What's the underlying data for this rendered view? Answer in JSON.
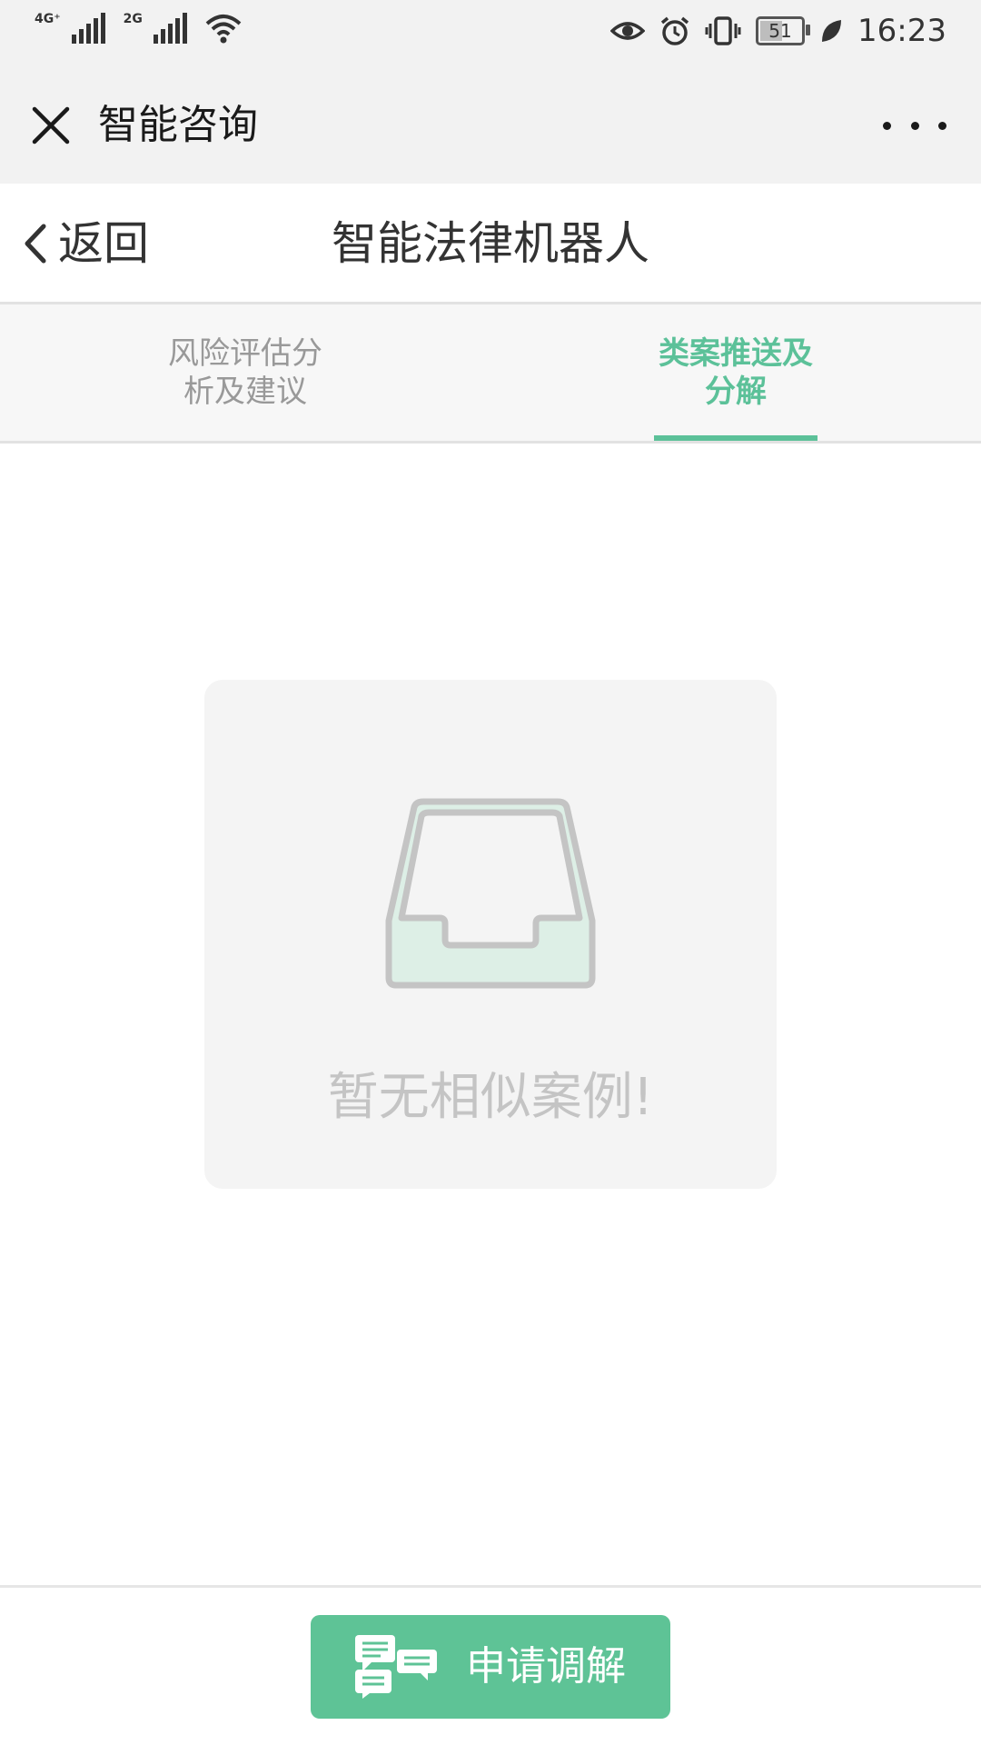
{
  "status_bar": {
    "network_1": "4G⁺",
    "network_2": "2G",
    "battery_level": "51",
    "time": "16:23"
  },
  "title_bar": {
    "title": "智能咨询"
  },
  "page_header": {
    "back_label": "返回",
    "title": "智能法律机器人"
  },
  "tabs": [
    {
      "line1": "风险评估分",
      "line2": "析及建议",
      "active": false
    },
    {
      "line1": "类案推送及",
      "line2": "分解",
      "active": true
    }
  ],
  "empty_state": {
    "icon": "inbox-icon",
    "message": "暂无相似案例!"
  },
  "action": {
    "icon": "chat-bubbles-icon",
    "label": "申请调解"
  },
  "colors": {
    "accent": "#5cc199",
    "button": "#5ec396",
    "muted_text": "#999999"
  }
}
